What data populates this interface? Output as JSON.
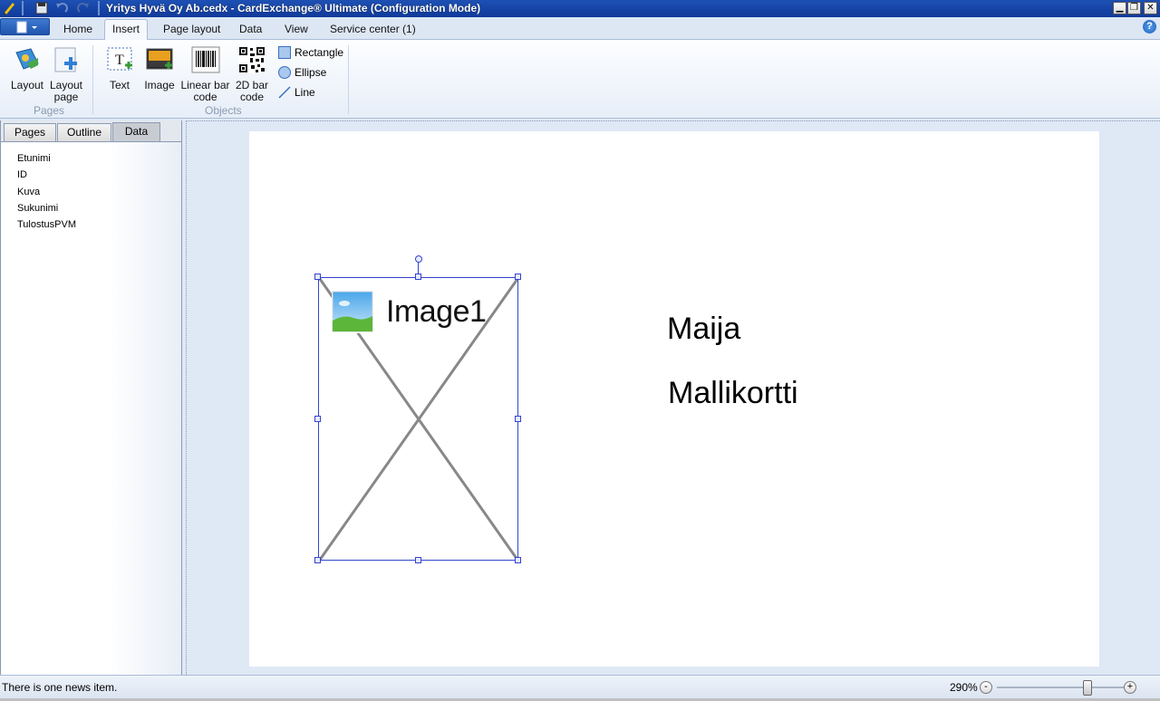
{
  "window": {
    "title": "Yritys Hyvä Oy Ab.cedx - CardExchange® Ultimate (Configuration Mode)",
    "minimize_glyph": "▁",
    "restore_glyph": "❐",
    "close_glyph": "✕"
  },
  "tabs": [
    {
      "label": "Home",
      "active": false
    },
    {
      "label": "Insert",
      "active": true
    },
    {
      "label": "Page layout",
      "active": false
    },
    {
      "label": "Data",
      "active": false
    },
    {
      "label": "View",
      "active": false
    },
    {
      "label": "Service center (1)",
      "active": false
    }
  ],
  "help_glyph": "?",
  "ribbon": {
    "pages_group": {
      "label": "Pages",
      "layout": "Layout",
      "layout_page_line1": "Layout",
      "layout_page_line2": "page"
    },
    "objects_group": {
      "label": "Objects",
      "text": "Text",
      "image": "Image",
      "linear_line1": "Linear bar",
      "linear_line2": "code",
      "twod_line1": "2D bar",
      "twod_line2": "code",
      "rectangle": "Rectangle",
      "ellipse": "Ellipse",
      "line": "Line"
    }
  },
  "left_panel": {
    "tabs": [
      "Pages",
      "Outline",
      "Data"
    ],
    "active_tab": "Data",
    "fields": [
      "Etunimi",
      "ID",
      "Kuva",
      "Sukunimi",
      "TulostusPVM"
    ]
  },
  "canvas": {
    "image_object_label": "Image1",
    "text_first_name": "Maija",
    "text_last_name": "Mallikortti"
  },
  "status": {
    "message": "There is one news item.",
    "zoom": "290%",
    "zoom_out_glyph": "-",
    "zoom_in_glyph": "+"
  },
  "colors": {
    "title_bar": "#1e50b4",
    "selection": "#3344cc",
    "ribbon_bg": "#f5f8fc"
  }
}
